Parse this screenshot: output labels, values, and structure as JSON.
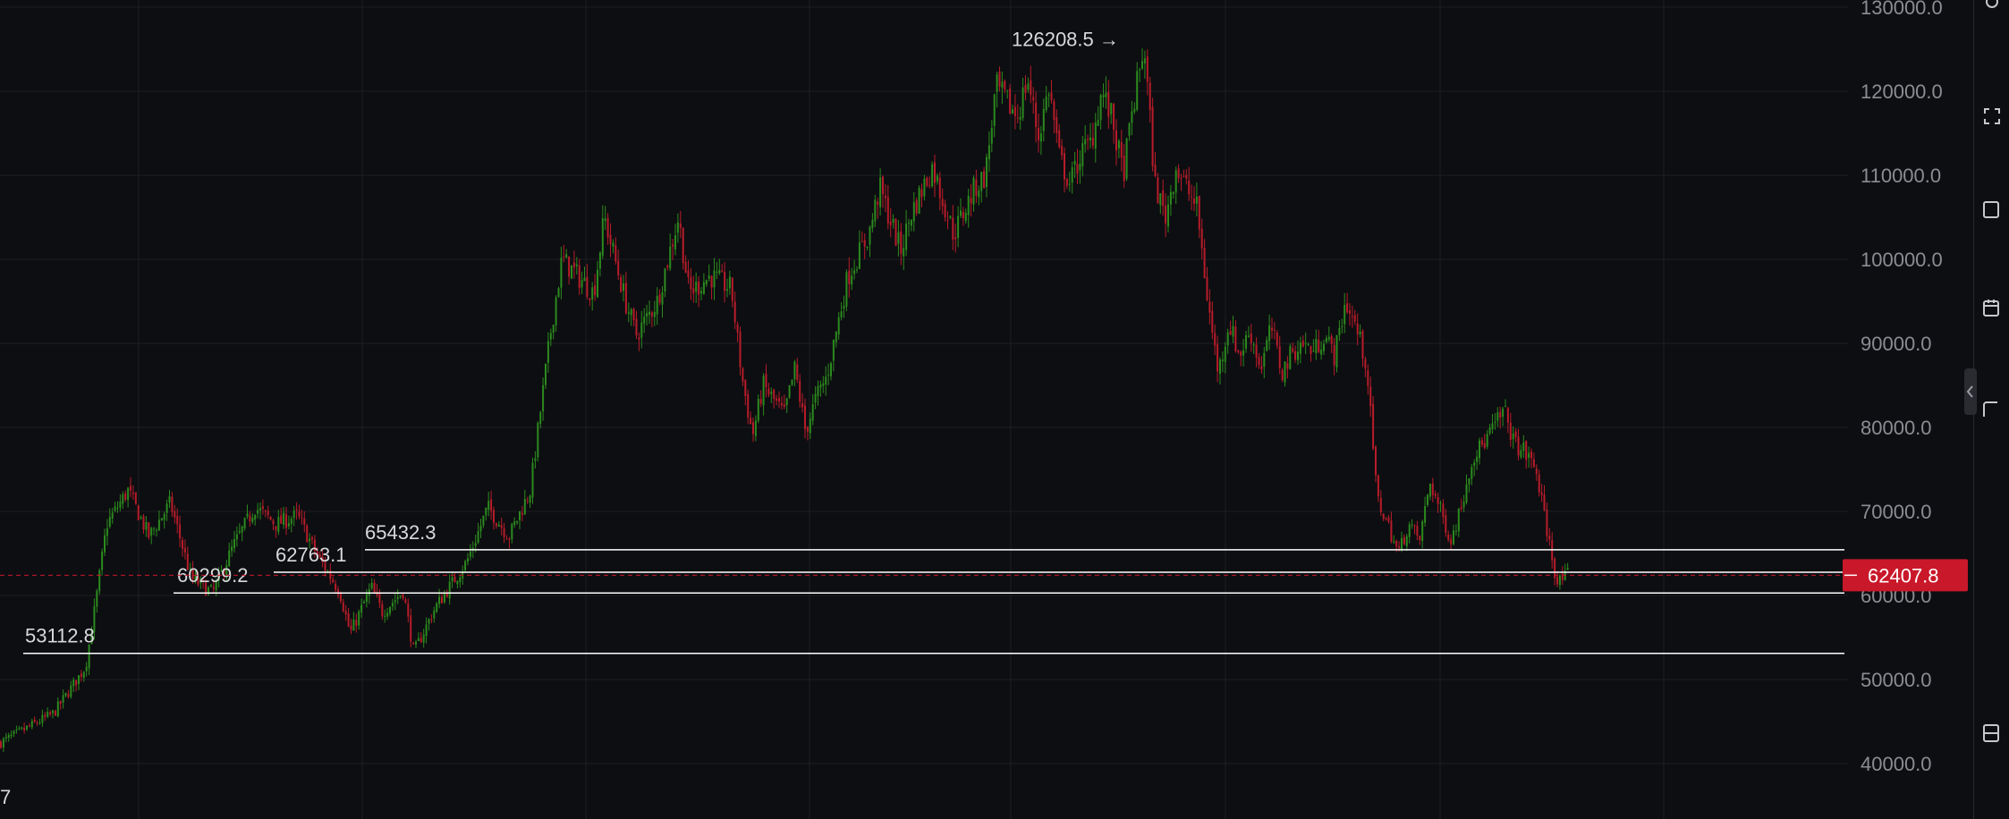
{
  "chart_data": {
    "type": "candlestick",
    "y_axis": {
      "ticks": [
        "130000.0",
        "120000.0",
        "110000.0",
        "100000.0",
        "90000.0",
        "80000.0",
        "70000.0",
        "60000.0",
        "50000.0",
        "40000.0"
      ],
      "tick_values": [
        130000,
        120000,
        110000,
        100000,
        90000,
        80000,
        70000,
        60000,
        50000,
        40000
      ],
      "range": [
        35500,
        131000
      ],
      "position": "right"
    },
    "grid": true,
    "colors": {
      "background": "#0d0e11",
      "grid": "#1d1f24",
      "up": "#2b8a1e",
      "down": "#b71c2a",
      "level_line": "#ffffff",
      "current_price": "#c9182a",
      "axis_text": "#8b8d93",
      "label_text": "#d8d9dc"
    },
    "close_path": [
      [
        0,
        42500
      ],
      [
        5,
        46000
      ],
      [
        8,
        51500
      ],
      [
        9,
        59500
      ],
      [
        10,
        68500
      ],
      [
        12,
        72500
      ],
      [
        14,
        67000
      ],
      [
        16,
        71000
      ],
      [
        18,
        62000
      ],
      [
        20,
        60300
      ],
      [
        22,
        66000
      ],
      [
        24,
        70500
      ],
      [
        26,
        68500
      ],
      [
        28,
        69500
      ],
      [
        30,
        64500
      ],
      [
        32,
        60500
      ],
      [
        33,
        55500
      ],
      [
        35,
        61000
      ],
      [
        36,
        58000
      ],
      [
        38,
        60500
      ],
      [
        39,
        53200
      ],
      [
        41,
        58500
      ],
      [
        44,
        64000
      ],
      [
        46,
        70500
      ],
      [
        48,
        67000
      ],
      [
        50,
        72500
      ],
      [
        52,
        92000
      ],
      [
        53,
        100000
      ],
      [
        56,
        96000
      ],
      [
        57,
        105000
      ],
      [
        59,
        95000
      ],
      [
        60,
        91000
      ],
      [
        62,
        95000
      ],
      [
        64,
        105000
      ],
      [
        65,
        96000
      ],
      [
        67,
        98000
      ],
      [
        69,
        96500
      ],
      [
        70,
        86000
      ],
      [
        71,
        79000
      ],
      [
        72,
        85000
      ],
      [
        74,
        81500
      ],
      [
        75,
        87000
      ],
      [
        76,
        79500
      ],
      [
        77,
        83500
      ],
      [
        78,
        86000
      ],
      [
        80,
        98000
      ],
      [
        82,
        103000
      ],
      [
        83,
        108500
      ],
      [
        85,
        101000
      ],
      [
        86,
        105500
      ],
      [
        88,
        111000
      ],
      [
        90,
        103000
      ],
      [
        92,
        108500
      ],
      [
        93,
        110000
      ],
      [
        94,
        120500
      ],
      [
        96,
        117000
      ],
      [
        97,
        121500
      ],
      [
        98,
        114500
      ],
      [
        99,
        120500
      ],
      [
        100,
        112000
      ],
      [
        101,
        109000
      ],
      [
        102,
        112500
      ],
      [
        103,
        114000
      ],
      [
        104,
        120000
      ],
      [
        105,
        116500
      ],
      [
        106,
        110000
      ],
      [
        107,
        118500
      ],
      [
        108,
        125500
      ],
      [
        109,
        109000
      ],
      [
        110,
        105000
      ],
      [
        111,
        111000
      ],
      [
        113,
        106000
      ],
      [
        114,
        95000
      ],
      [
        115,
        86500
      ],
      [
        116,
        92500
      ],
      [
        117,
        88500
      ],
      [
        118,
        91500
      ],
      [
        119,
        87000
      ],
      [
        120,
        92000
      ],
      [
        121,
        86500
      ],
      [
        122,
        89000
      ],
      [
        123,
        90000
      ],
      [
        124,
        89000
      ],
      [
        125,
        91000
      ],
      [
        126,
        88500
      ],
      [
        127,
        95000
      ],
      [
        128,
        92000
      ],
      [
        129,
        87500
      ],
      [
        130,
        71500
      ],
      [
        131,
        68500
      ],
      [
        132,
        65000
      ],
      [
        133,
        68500
      ],
      [
        134,
        66500
      ],
      [
        135,
        73500
      ],
      [
        136,
        70000
      ],
      [
        137,
        66500
      ],
      [
        138,
        71000
      ],
      [
        139,
        76500
      ],
      [
        140,
        78000
      ],
      [
        141,
        80000
      ],
      [
        142,
        82000
      ],
      [
        143,
        78000
      ],
      [
        144,
        77000
      ],
      [
        145,
        75000
      ],
      [
        146,
        68000
      ],
      [
        147,
        61500
      ],
      [
        148,
        62407.8
      ]
    ],
    "last_price": "62407.8",
    "last_price_value": 62407.8,
    "peak_annotation": {
      "label": "126208.5",
      "arrow": "→",
      "value": 126208.5
    },
    "horizontal_levels": [
      {
        "label": "65432.3",
        "value": 65432.3
      },
      {
        "label": "62763.1",
        "value": 62763.1
      },
      {
        "label": "60299.2",
        "value": 60299.2
      },
      {
        "label": "53112.8",
        "value": 53112.8
      }
    ],
    "bottom_left_fragment": "7"
  },
  "sidebar": {
    "icons": [
      "gear-icon",
      "fullscreen-icon",
      "camera-icon",
      "calendar-icon",
      "chat-icon",
      "layout-icon"
    ],
    "collapse_icon": "chevron-left-icon"
  }
}
